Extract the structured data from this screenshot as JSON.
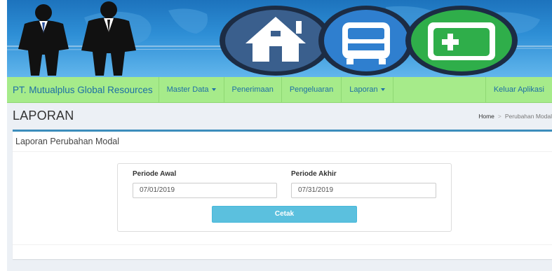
{
  "navbar": {
    "brand": "PT. Mutualplus Global Resources",
    "items": [
      {
        "label": "Master Data",
        "dropdown": true
      },
      {
        "label": "Penerimaan",
        "dropdown": false
      },
      {
        "label": "Pengeluaran",
        "dropdown": false
      },
      {
        "label": "Laporan",
        "dropdown": true
      }
    ],
    "right": "Keluar Aplikasi"
  },
  "page": {
    "title": "LAPORAN",
    "breadcrumb": {
      "home": "Home",
      "current": "Perubahan Modal"
    }
  },
  "box": {
    "title": "Laporan Perubahan Modal",
    "periode_awal_label": "Periode Awal",
    "periode_awal_value": "07/01/2019",
    "periode_akhir_label": "Periode Akhir",
    "periode_akhir_value": "07/31/2019",
    "cetak_label": "Cetak"
  },
  "colors": {
    "navbar": "#a6eb8a",
    "brand_text": "#1d6fa5",
    "box_border": "#3c8dbc",
    "button": "#5bc0de"
  },
  "icons": [
    "business-people-silhouette",
    "house-icon",
    "bus-icon",
    "wallet-icon"
  ]
}
